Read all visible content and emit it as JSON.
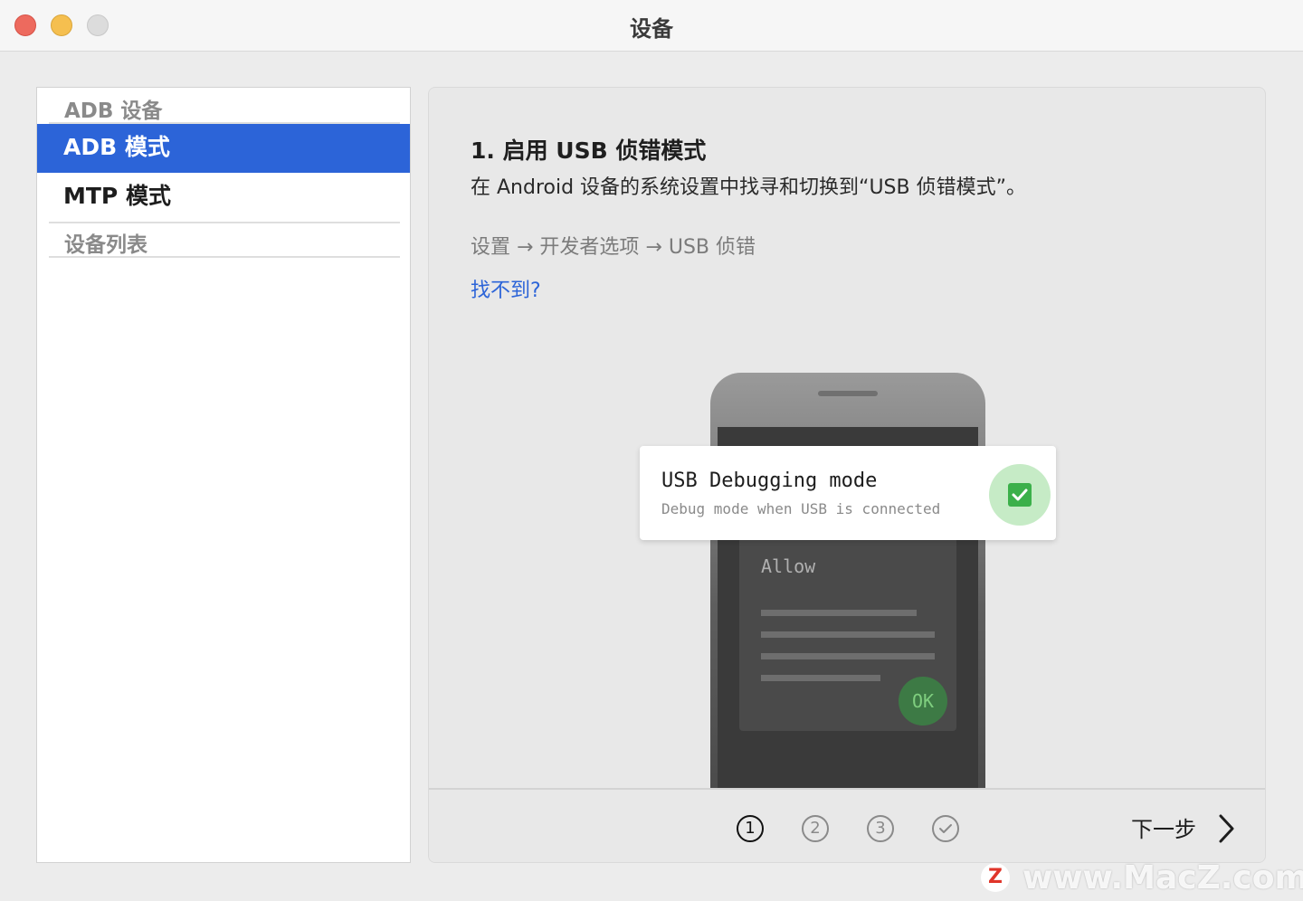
{
  "window": {
    "title": "设备"
  },
  "sidebar": {
    "header_adb": "ADB 设备",
    "items": [
      {
        "label": "ADB 模式",
        "active": true
      },
      {
        "label": "MTP 模式",
        "active": false
      }
    ],
    "header_devices": "设备列表"
  },
  "main": {
    "step_title": "1. 启用 USB 侦错模式",
    "step_desc": "在 Android 设备的系统设置中找寻和切换到“USB 侦错模式”。",
    "path": "设置 → 开发者选项 → USB 侦错",
    "help_link": "找不到?",
    "illustration": {
      "dialog_title": "Allow",
      "ok_label": "OK",
      "toast_title": "USB Debugging mode",
      "toast_subtitle": "Debug mode when USB is connected",
      "check_icon": "check-icon"
    },
    "steps": [
      "①",
      "②",
      "③",
      "check-icon"
    ],
    "current_step": 1,
    "next_label": "下一步"
  },
  "watermark": {
    "logo": "Z",
    "text": "www.MacZ.com"
  },
  "colors": {
    "accent": "#2c64d8",
    "success": "#3bb04a"
  }
}
